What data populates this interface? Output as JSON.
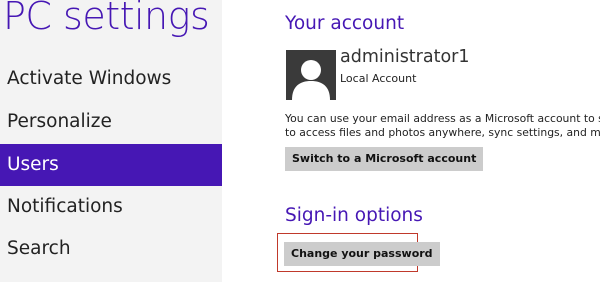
{
  "app": {
    "title": "PC settings"
  },
  "sidebar": {
    "items": [
      {
        "label": "Activate Windows",
        "selected": false
      },
      {
        "label": "Personalize",
        "selected": false
      },
      {
        "label": "Users",
        "selected": true
      },
      {
        "label": "Notifications",
        "selected": false
      },
      {
        "label": "Search",
        "selected": false
      }
    ]
  },
  "account": {
    "heading": "Your account",
    "avatar_icon": "default-user-avatar-icon",
    "user_name": "administrator1",
    "account_type": "Local Account",
    "description_line1": "You can use your email address as a Microsoft account to sign in",
    "description_line2": "to access files and photos anywhere, sync settings, and more.",
    "switch_button_label": "Switch to a Microsoft account"
  },
  "signin": {
    "heading": "Sign-in options",
    "change_password_label": "Change your password"
  },
  "colors": {
    "accent": "#4617b4",
    "sidebar_bg": "#f3f3f3",
    "button_bg": "#cccccc",
    "highlight_border": "#c0392b"
  }
}
